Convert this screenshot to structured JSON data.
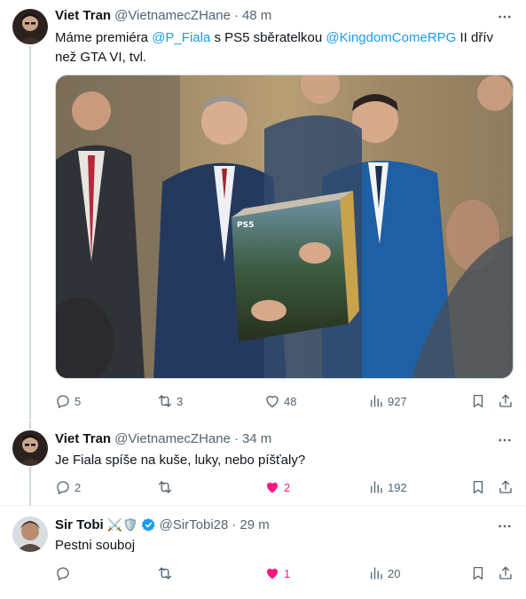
{
  "tweets": [
    {
      "name": "Viet Tran",
      "handle": "@VietnamecZHane",
      "time": "48 m",
      "text_parts": [
        "Máme premiéra ",
        "@P_Fiala",
        " s PS5 sběratelkou ",
        "@KingdomComeRPG",
        " II dřív než GTA VI, tvl."
      ],
      "media_label": "PS5",
      "stats": {
        "replies": "5",
        "retweets": "3",
        "likes": "48",
        "views": "927"
      }
    },
    {
      "name": "Viet Tran",
      "handle": "@VietnamecZHane",
      "time": "34 m",
      "text": "Je Fiala spíše na kuše, luky, nebo píšťaly?",
      "stats": {
        "replies": "2",
        "retweets": "",
        "likes": "2",
        "views": "192"
      }
    },
    {
      "name": "Sir Tobi",
      "badges": "⚔️🛡️",
      "handle": "@SirTobi28",
      "time": "29 m",
      "text": "Pestni souboj",
      "stats": {
        "replies": "",
        "retweets": "",
        "likes": "1",
        "views": "20"
      }
    }
  ],
  "separator": "·",
  "colors": {
    "accent": "#1d9bf0",
    "like": "#f91880",
    "muted": "#536471"
  }
}
